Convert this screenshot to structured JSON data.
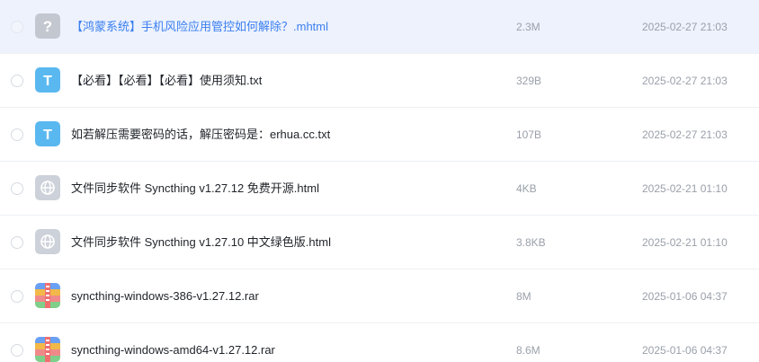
{
  "files": [
    {
      "name": "【鸿蒙系统】手机风险应用管控如何解除？.mhtml",
      "size": "2.3M",
      "date": "2025-02-27 21:03",
      "icon": "unknown-file-icon",
      "selected": true
    },
    {
      "name": "【必看】【必看】【必看】使用须知.txt",
      "size": "329B",
      "date": "2025-02-27 21:03",
      "icon": "text-file-icon",
      "selected": false
    },
    {
      "name": "如若解压需要密码的话，解压密码是：erhua.cc.txt",
      "size": "107B",
      "date": "2025-02-27 21:03",
      "icon": "text-file-icon",
      "selected": false
    },
    {
      "name": "文件同步软件 Syncthing v1.27.12 免费开源.html",
      "size": "4KB",
      "date": "2025-02-21 01:10",
      "icon": "web-file-icon",
      "selected": false
    },
    {
      "name": "文件同步软件 Syncthing v1.27.10 中文绿色版.html",
      "size": "3.8KB",
      "date": "2025-02-21 01:10",
      "icon": "web-file-icon",
      "selected": false
    },
    {
      "name": "syncthing-windows-386-v1.27.12.rar",
      "size": "8M",
      "date": "2025-01-06 04:37",
      "icon": "archive-file-icon",
      "selected": false
    },
    {
      "name": "syncthing-windows-amd64-v1.27.12.rar",
      "size": "8.6M",
      "date": "2025-01-06 04:37",
      "icon": "archive-file-icon",
      "selected": false
    }
  ],
  "colors": {
    "accent": "#3b7ff0",
    "selected_row_bg": "#edf2fd",
    "text_icon": "#5ab8f0",
    "unknown_icon": "#c3c7d0"
  }
}
